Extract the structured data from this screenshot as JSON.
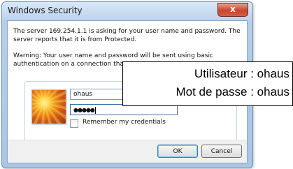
{
  "window": {
    "title": "Windows Security",
    "close_label": "x"
  },
  "message": {
    "line1": "The server 169.254.1.1 is asking for your user name and password. The server reports that it is from Protected.",
    "line2": "Warning: Your user name and password will be sent using basic authentication on a connection that"
  },
  "credentials": {
    "username_value": "ohaus",
    "password_mask": "●●●●●",
    "remember_label": "Remember my credentials",
    "remember_checked": false
  },
  "buttons": {
    "ok_label": "OK",
    "cancel_label": "Cancel"
  },
  "annotation": {
    "user_line": "Utilisateur : ohaus",
    "password_line": "Mot de passe : ohaus"
  },
  "colors": {
    "frame": "#b7cfea",
    "close": "#c8442f",
    "field_border": "#7f9db9"
  }
}
